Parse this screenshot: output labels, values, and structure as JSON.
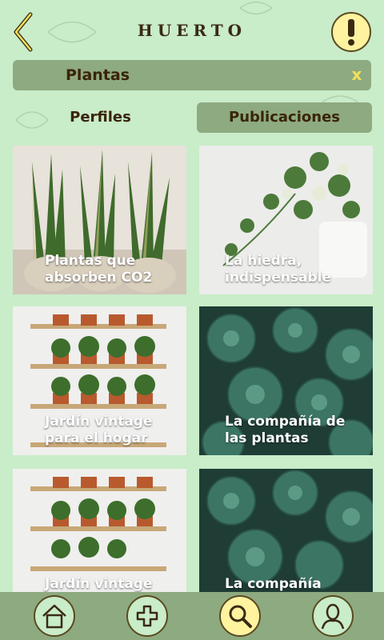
{
  "header": {
    "title": "HUERTO",
    "back_icon": "chevron-left-icon",
    "alert_icon": "exclamation-icon"
  },
  "search": {
    "value": "Plantas",
    "clear_label": "x"
  },
  "tabs": [
    {
      "label": "Perfiles",
      "active": false
    },
    {
      "label": "Publicaciones",
      "active": true
    }
  ],
  "cards": [
    {
      "label": "Plantas que absorben CO2",
      "image": "snake-plants"
    },
    {
      "label": "La hiedra, indispensable",
      "image": "ivy-pots"
    },
    {
      "label": "Jardín vintage para el hogar",
      "image": "herb-shelves"
    },
    {
      "label": "La compañía de las plantas",
      "image": "succulents"
    },
    {
      "label": "Jardín vintage",
      "image": "herb-shelves"
    },
    {
      "label": "La compañía",
      "image": "succulents"
    }
  ],
  "nav": {
    "items": [
      {
        "icon": "home-icon"
      },
      {
        "icon": "add-icon"
      },
      {
        "icon": "search-icon",
        "active": true
      },
      {
        "icon": "profile-icon"
      }
    ]
  },
  "colors": {
    "background": "#c9ecc9",
    "accent": "#8eaa80",
    "highlight": "#fff3a0",
    "text": "#3a2408"
  }
}
